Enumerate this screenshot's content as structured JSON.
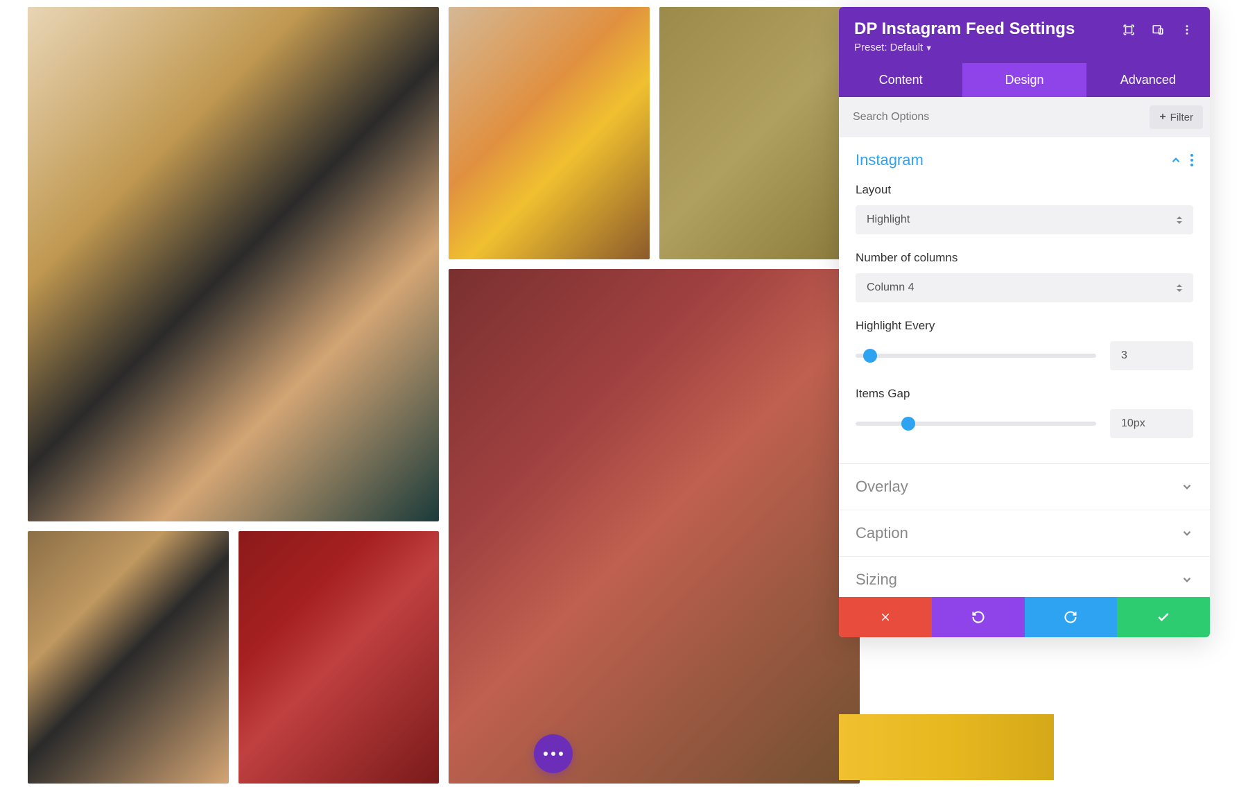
{
  "panel": {
    "title": "DP Instagram Feed Settings",
    "preset_label": "Preset: Default"
  },
  "tabs": {
    "content": "Content",
    "design": "Design",
    "advanced": "Advanced"
  },
  "search": {
    "placeholder": "Search Options",
    "filter_label": "Filter"
  },
  "sections": {
    "instagram": {
      "title": "Instagram",
      "layout_label": "Layout",
      "layout_value": "Highlight",
      "columns_label": "Number of columns",
      "columns_value": "Column 4",
      "highlight_every_label": "Highlight Every",
      "highlight_every_value": "3",
      "items_gap_label": "Items Gap",
      "items_gap_value": "10px"
    },
    "overlay": {
      "title": "Overlay"
    },
    "caption": {
      "title": "Caption"
    },
    "sizing": {
      "title": "Sizing"
    }
  },
  "icons": {
    "expand": "expand-icon",
    "responsive": "responsive-icon",
    "menu": "menu-icon"
  }
}
